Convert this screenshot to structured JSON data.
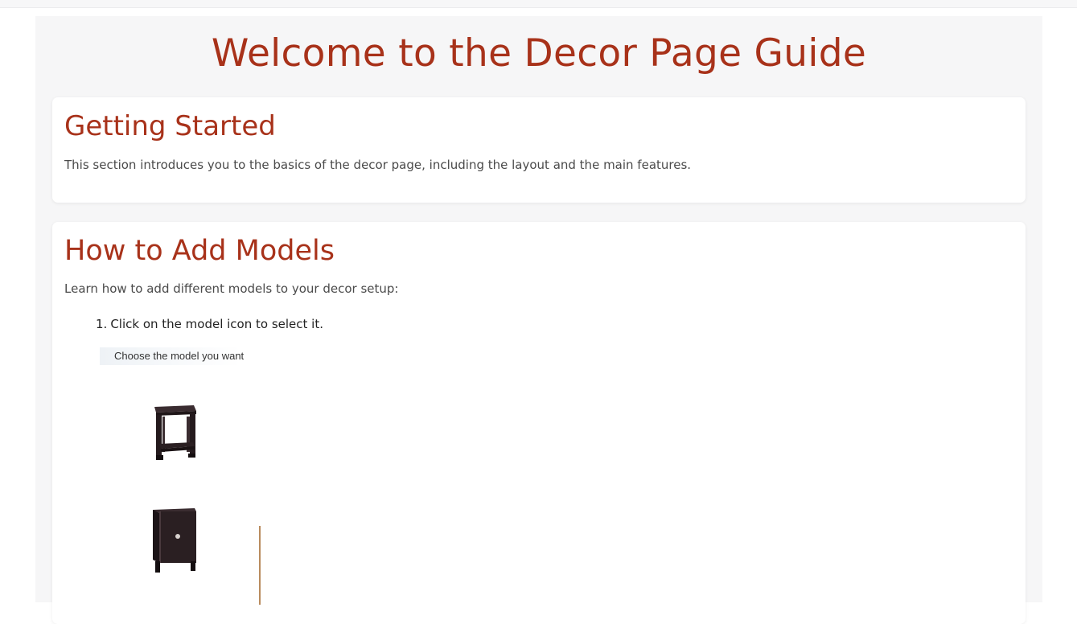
{
  "page": {
    "title": "Welcome to the Decor Page Guide"
  },
  "sections": [
    {
      "heading": "Getting Started",
      "body": "This section introduces you to the basics of the decor page, including the layout and the main features."
    },
    {
      "heading": "How to Add Models",
      "body": "Learn how to add different models to your decor setup:",
      "steps": [
        {
          "number": "1.",
          "text": "Click on the model icon to select it."
        }
      ],
      "screenshot": {
        "label": "Choose the model you want",
        "models": [
          {
            "icon": "side-table-icon"
          },
          {
            "icon": "nightstand-cabinet-icon"
          }
        ]
      }
    }
  ],
  "colors": {
    "heading": "#a8321a",
    "page_bg": "#f6f6f7",
    "card_bg": "#ffffff",
    "furniture": "#2a1f22"
  }
}
